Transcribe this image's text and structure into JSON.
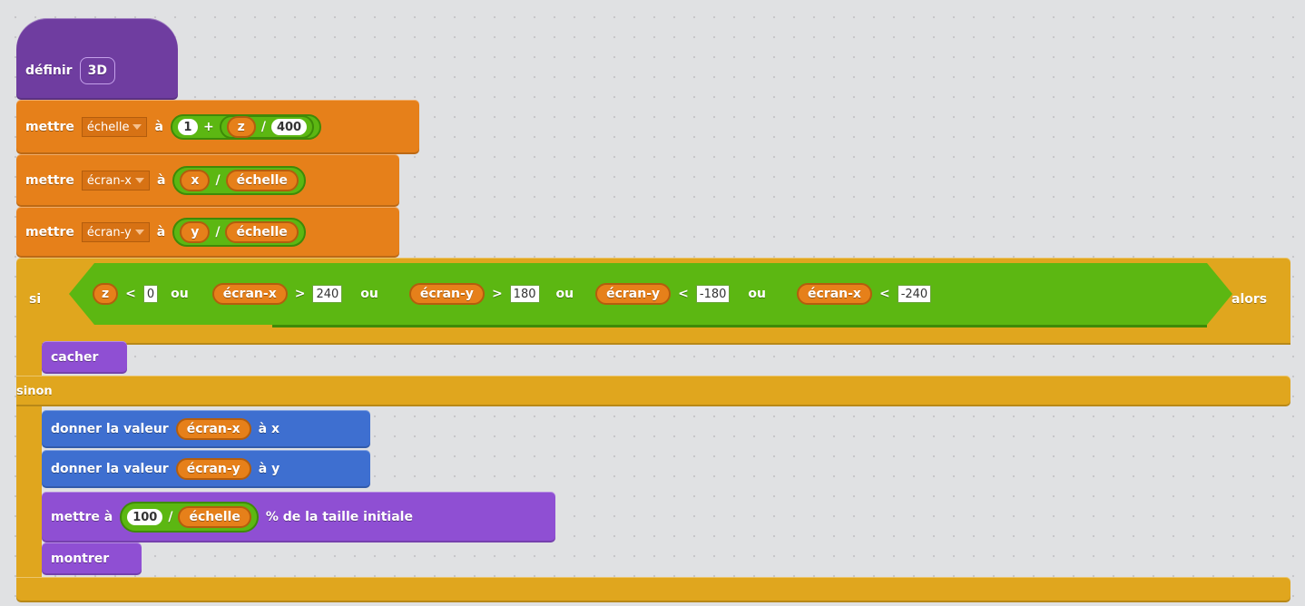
{
  "define": {
    "keyword": "définir",
    "name": "3D"
  },
  "set_scale": {
    "keyword": "mettre",
    "variable": "échelle",
    "to": "à",
    "one": "1",
    "plus": "+",
    "z": "z",
    "div": "/",
    "divisor": "400"
  },
  "set_screen_x": {
    "keyword": "mettre",
    "variable": "écran-x",
    "to": "à",
    "x": "x",
    "div": "/",
    "scale": "échelle"
  },
  "set_screen_y": {
    "keyword": "mettre",
    "variable": "écran-y",
    "to": "à",
    "y": "y",
    "div": "/",
    "scale": "échelle"
  },
  "if_block": {
    "si": "si",
    "alors": "alors",
    "sinon": "sinon",
    "or": "ou",
    "cond1": {
      "var": "z",
      "op": "<",
      "value": "0"
    },
    "cond2": {
      "var": "écran-x",
      "op": ">",
      "value": "240"
    },
    "cond3": {
      "var": "écran-y",
      "op": ">",
      "value": "180"
    },
    "cond4": {
      "var": "écran-y",
      "op": "<",
      "value": "-180"
    },
    "cond5": {
      "var": "écran-x",
      "op": "<",
      "value": "-240"
    }
  },
  "hide": {
    "label": "cacher"
  },
  "set_x": {
    "label": "donner la valeur",
    "var": "écran-x",
    "suffix": "à x"
  },
  "set_y": {
    "label": "donner la valeur",
    "var": "écran-y",
    "suffix": "à y"
  },
  "set_size": {
    "label": "mettre à",
    "value": "100",
    "div": "/",
    "var": "échelle",
    "suffix": "% de la taille initiale"
  },
  "show": {
    "label": "montrer"
  },
  "colors": {
    "events": "#6f3da0",
    "data": "#e6801a",
    "control": "#e0a61e",
    "motion": "#3e6fd0",
    "looks": "#8f4fd3",
    "operators": "#5cb712"
  }
}
